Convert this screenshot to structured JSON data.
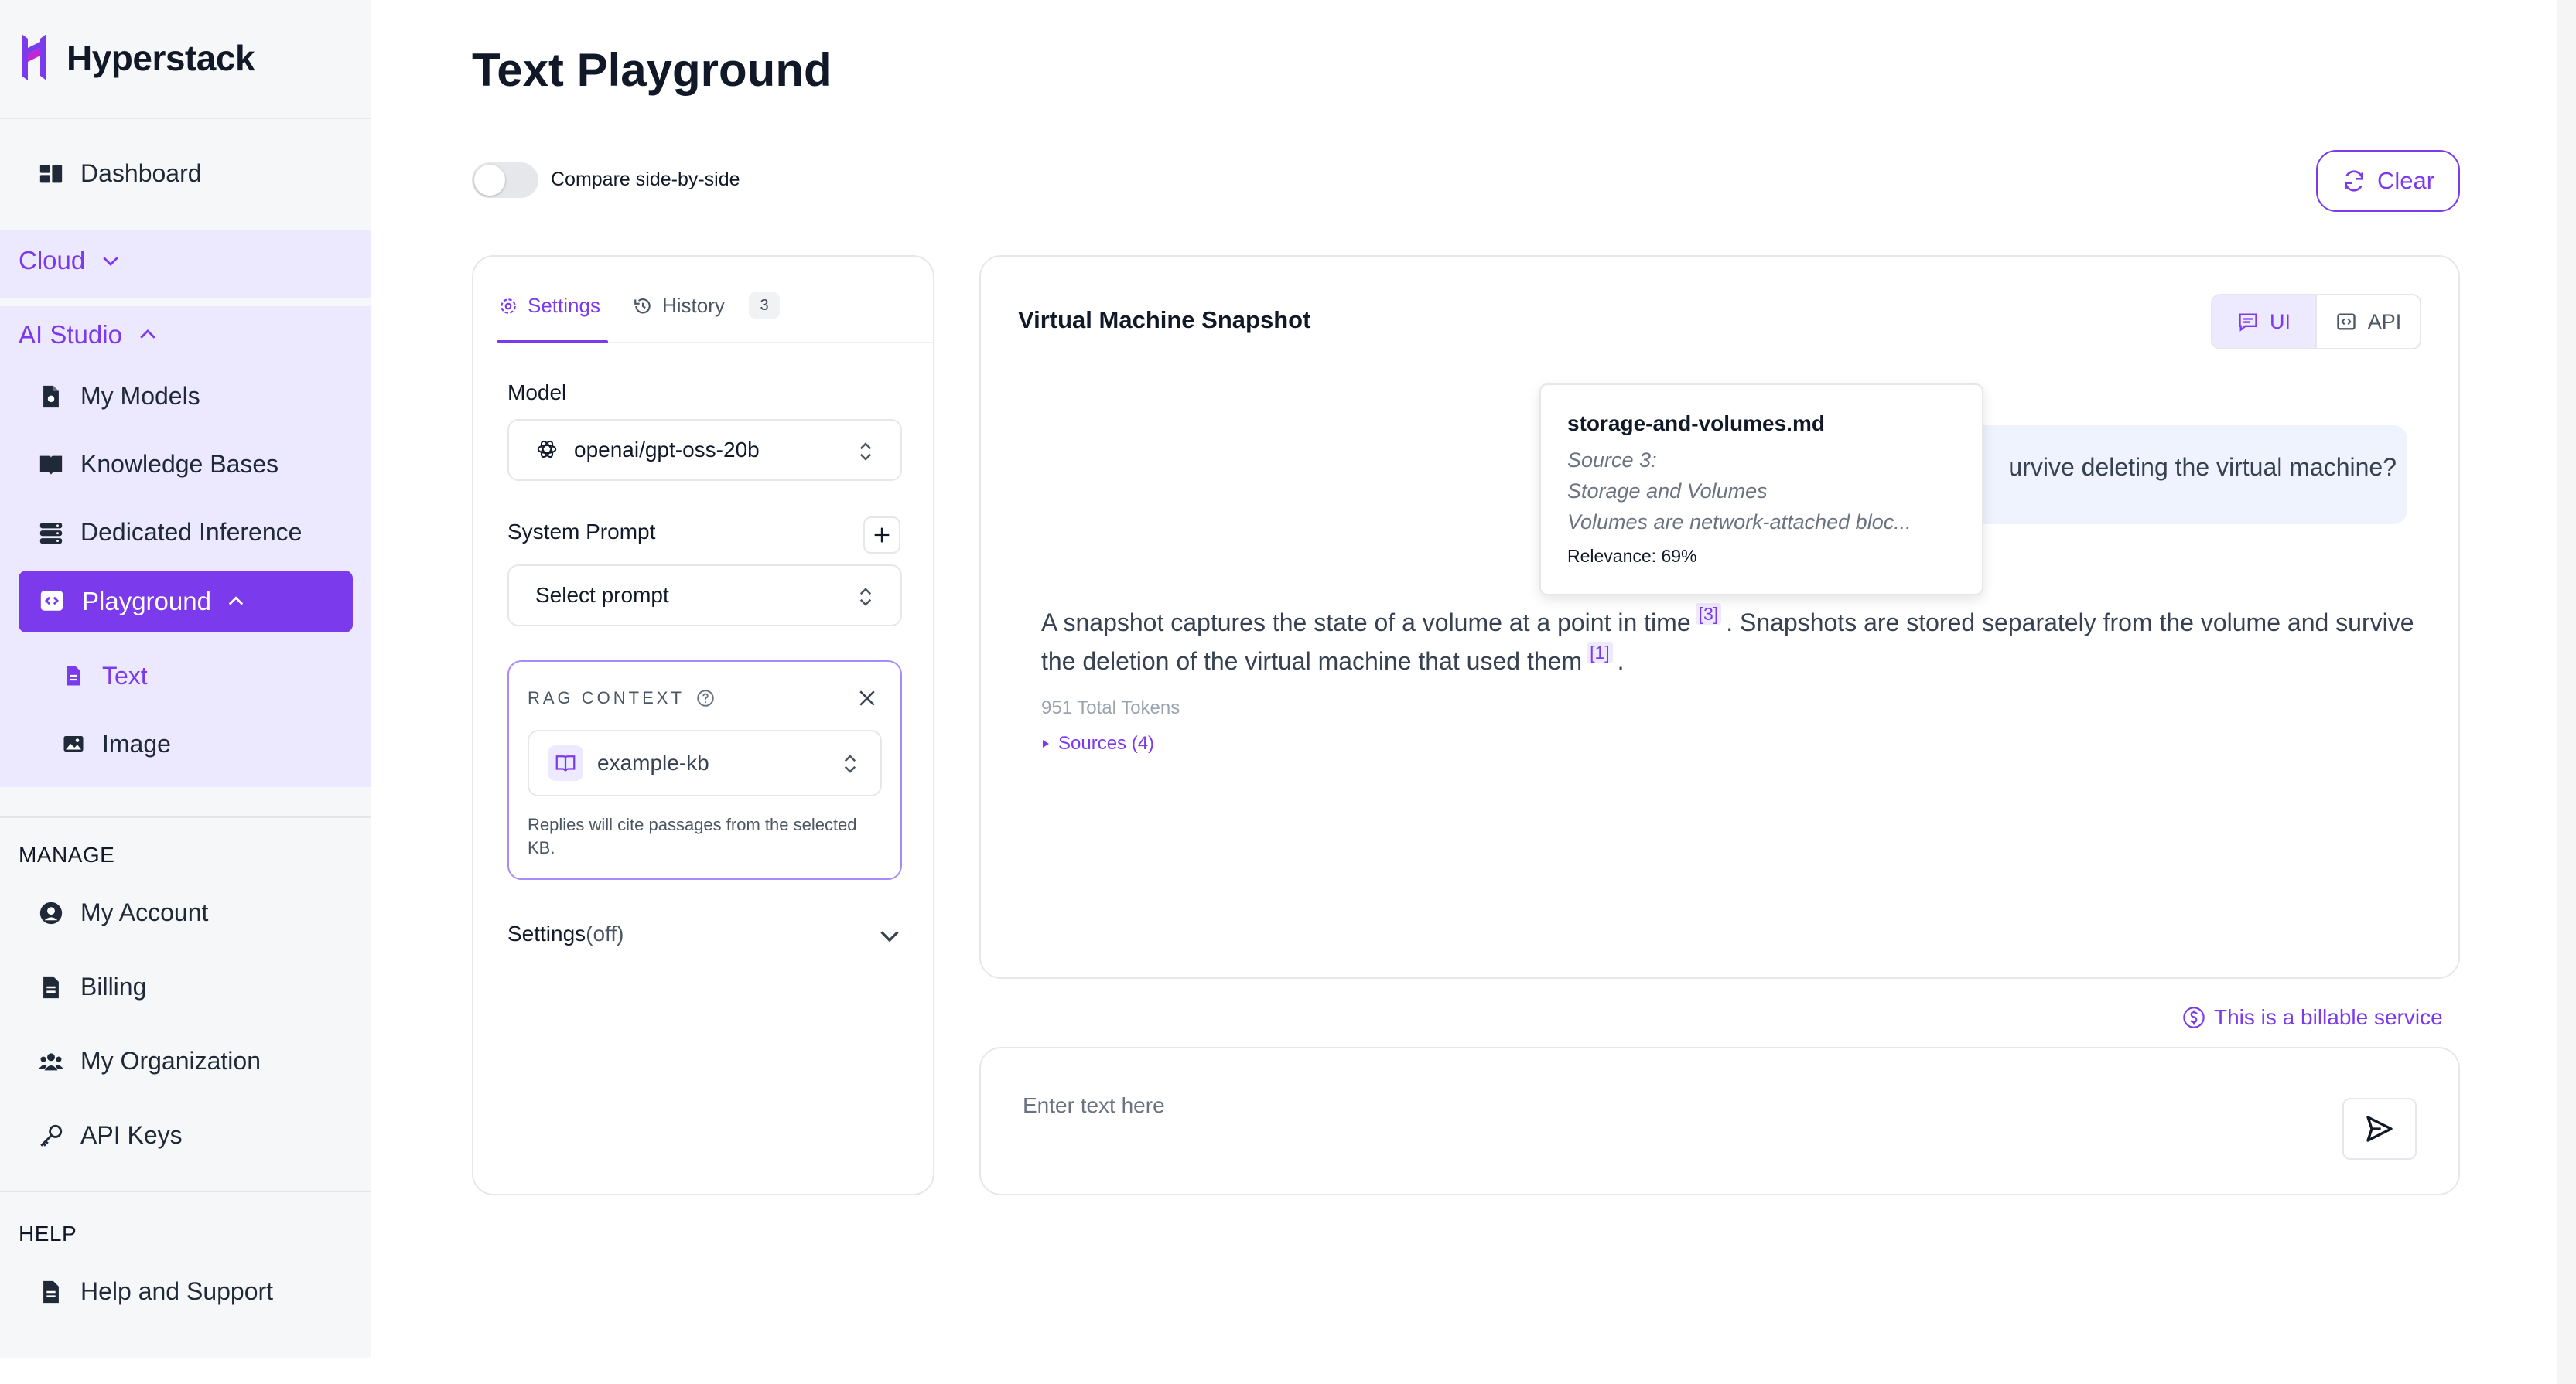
{
  "app": {
    "name": "Hyperstack"
  },
  "sidebar": {
    "dashboard": "Dashboard",
    "cloud": "Cloud",
    "ai_studio": "AI Studio",
    "my_models": "My Models",
    "knowledge_bases": "Knowledge Bases",
    "dedicated_inference": "Dedicated Inference",
    "playground": "Playground",
    "text": "Text",
    "image": "Image",
    "manage_label": "MANAGE",
    "my_account": "My Account",
    "billing": "Billing",
    "my_organization": "My Organization",
    "api_keys": "API Keys",
    "help_label": "HELP",
    "help_support": "Help and Support"
  },
  "page": {
    "title": "Text Playground",
    "compare_label": "Compare side-by-side",
    "compare_enabled": false,
    "clear_label": "Clear"
  },
  "settings_panel": {
    "tab_settings": "Settings",
    "tab_history": "History",
    "history_count": "3",
    "model_label": "Model",
    "model_value": "openai/gpt-oss-20b",
    "system_prompt_label": "System Prompt",
    "system_prompt_value": "Select prompt",
    "rag": {
      "title": "RAG CONTEXT",
      "kb_value": "example-kb",
      "help": "Replies will cite passages from the selected KB."
    },
    "settings_label": "Settings",
    "settings_state": "(off)"
  },
  "chat": {
    "title": "Virtual Machine Snapshot",
    "mode_ui": "UI",
    "mode_api": "API",
    "user_message_visible": "urvive deleting the virtual machine?",
    "answer_part1": "A snapshot captures the state of a volume at a point in time",
    "cite_a": "[3]",
    "answer_part2": ". Snapshots are stored separately from the volume and survive the deletion of the virtual machine that used them",
    "cite_b": "[1]",
    "answer_end": ".",
    "tokens": "951 Total Tokens",
    "sources": "Sources (4)",
    "tooltip": {
      "file": "storage-and-volumes.md",
      "source": "Source 3:",
      "section": "Storage and Volumes",
      "snippet": "Volumes are network-attached bloc...",
      "relevance": "Relevance: 69%"
    }
  },
  "footer": {
    "billable": "This is a billable service",
    "input_placeholder": "Enter text here"
  },
  "colors": {
    "accent": "#7c3aed",
    "accent_light": "#ede9fe",
    "sidebar_bg": "#f6f7f8"
  }
}
